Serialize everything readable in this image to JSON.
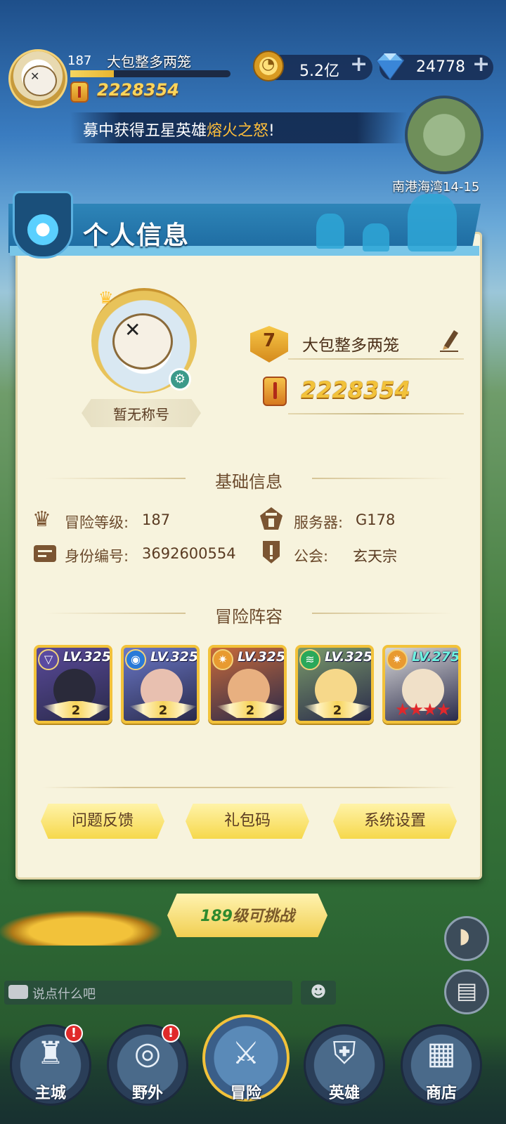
{
  "hud": {
    "player_level": "187",
    "player_name": "大包整多两笼",
    "xp_progress": 0.27,
    "combat_power": "2228354",
    "gold": "5.2亿",
    "gems": "24778",
    "plus_symbol": "+"
  },
  "ticker": {
    "text_before": "募中获得五星英雄",
    "highlight": "熔火之怒",
    "text_after": "!"
  },
  "minimap": {
    "location": "南港海湾14-15"
  },
  "panel": {
    "title": "个人信息",
    "profile": {
      "title_badge": "暂无称号",
      "vip_level": "7",
      "name": "大包整多两笼",
      "combat_power": "2228354"
    },
    "basic_info": {
      "heading": "基础信息",
      "adventure_level_label": "冒险等级:",
      "adventure_level": "187",
      "server_label": "服务器:",
      "server": "G178",
      "id_label": "身份编号:",
      "id": "3692600554",
      "guild_label": "公会:",
      "guild": "玄天宗"
    },
    "lineup": {
      "heading": "冒险阵容",
      "heroes": [
        {
          "level": "LV.325",
          "stars": "2",
          "element": "dark",
          "color": "#5a4a9a",
          "face": "#2a2a3a"
        },
        {
          "level": "LV.325",
          "stars": "2",
          "element": "water",
          "color": "#6a78c8",
          "face": "#e8c0b0"
        },
        {
          "level": "LV.325",
          "stars": "2",
          "element": "light",
          "color": "#c86a3a",
          "face": "#e8b080"
        },
        {
          "level": "LV.325",
          "stars": "2",
          "element": "wind",
          "color": "#7a9a6a",
          "face": "#f6d88a"
        },
        {
          "level": "LV.275",
          "stars": "★★★★",
          "element": "light",
          "color": "#d8d8d8",
          "face": "#f0e0c8"
        }
      ]
    },
    "buttons": {
      "feedback": "问题反馈",
      "gift_code": "礼包码",
      "settings": "系统设置"
    }
  },
  "challenge": {
    "level": "189",
    "suffix": "级可挑战"
  },
  "chat": {
    "placeholder": "说点什么吧"
  },
  "nav": {
    "items": [
      {
        "label": "主城",
        "alert": "!"
      },
      {
        "label": "野外",
        "alert": "!"
      },
      {
        "label": "冒险"
      },
      {
        "label": "英雄"
      },
      {
        "label": "商店"
      }
    ]
  },
  "colors": {
    "accent_gold": "#f2c23a",
    "panel_bg": "#f7f3dd",
    "header_blue": "#1d6aa0"
  }
}
